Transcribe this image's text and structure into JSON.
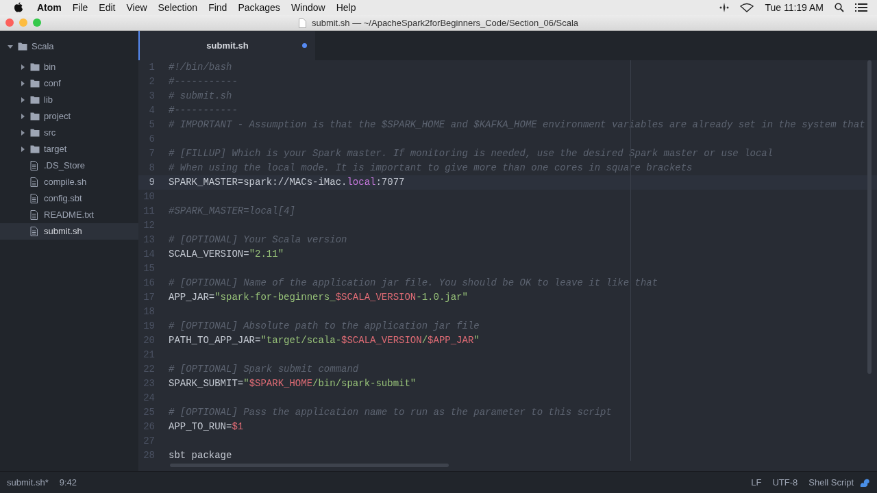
{
  "menu_bar": {
    "items": [
      {
        "label": "Atom",
        "kind": "app"
      },
      {
        "label": "File",
        "kind": "menu"
      },
      {
        "label": "Edit",
        "kind": "menu"
      },
      {
        "label": "View",
        "kind": "menu"
      },
      {
        "label": "Selection",
        "kind": "menu"
      },
      {
        "label": "Find",
        "kind": "menu"
      },
      {
        "label": "Packages",
        "kind": "menu"
      },
      {
        "label": "Window",
        "kind": "menu"
      },
      {
        "label": "Help",
        "kind": "menu"
      }
    ],
    "clock": "Tue 11:19 AM"
  },
  "window": {
    "title": "submit.sh — ~/ApacheSpark2forBeginners_Code/Section_06/Scala"
  },
  "tree": [
    {
      "label": "Scala",
      "kind": "folder",
      "expanded": true,
      "selected": false,
      "children": [
        {
          "label": "bin",
          "kind": "folder",
          "expanded": false,
          "selected": false
        },
        {
          "label": "conf",
          "kind": "folder",
          "expanded": false,
          "selected": false
        },
        {
          "label": "lib",
          "kind": "folder",
          "expanded": false,
          "selected": false
        },
        {
          "label": "project",
          "kind": "folder",
          "expanded": false,
          "selected": false
        },
        {
          "label": "src",
          "kind": "folder",
          "expanded": false,
          "selected": false
        },
        {
          "label": "target",
          "kind": "folder",
          "expanded": false,
          "selected": false
        },
        {
          "label": ".DS_Store",
          "kind": "file",
          "selected": false
        },
        {
          "label": "compile.sh",
          "kind": "file",
          "selected": false
        },
        {
          "label": "config.sbt",
          "kind": "file",
          "selected": false
        },
        {
          "label": "README.txt",
          "kind": "file",
          "selected": false
        },
        {
          "label": "submit.sh",
          "kind": "file",
          "selected": true
        }
      ]
    }
  ],
  "tabs": [
    {
      "label": "submit.sh",
      "selected": true,
      "modified": true
    }
  ],
  "editor": {
    "lines": [
      {
        "number": "1",
        "current": false,
        "tokens": [
          {
            "kind": "comment",
            "text": "#!/bin/bash"
          }
        ]
      },
      {
        "number": "2",
        "current": false,
        "tokens": [
          {
            "kind": "comment",
            "text": "#-----------"
          }
        ]
      },
      {
        "number": "3",
        "current": false,
        "tokens": [
          {
            "kind": "comment",
            "text": "# submit.sh"
          }
        ]
      },
      {
        "number": "4",
        "current": false,
        "tokens": [
          {
            "kind": "comment",
            "text": "#-----------"
          }
        ]
      },
      {
        "number": "5",
        "current": false,
        "tokens": [
          {
            "kind": "comment",
            "text": "# IMPORTANT - Assumption is that the $SPARK_HOME and $KAFKA_HOME environment variables are already set in the system that"
          }
        ]
      },
      {
        "number": "6",
        "current": false
      },
      {
        "number": "7",
        "current": false,
        "tokens": [
          {
            "kind": "comment",
            "text": "# [FILLUP] Which is your Spark master. If monitoring is needed, use the desired Spark master or use local"
          }
        ]
      },
      {
        "number": "8",
        "current": false,
        "tokens": [
          {
            "kind": "comment",
            "text": "# When using the local mode. It is important to give more than one cores in square brackets"
          }
        ]
      },
      {
        "number": "9",
        "current": true,
        "tokens": [
          {
            "kind": "text",
            "text": "SPARK_MASTER=spark://MACs-iMac."
          },
          {
            "kind": "keyword",
            "text": "local"
          },
          {
            "kind": "text",
            "text": ":7077"
          }
        ]
      },
      {
        "number": "10",
        "current": false
      },
      {
        "number": "11",
        "current": false,
        "tokens": [
          {
            "kind": "comment",
            "text": "#SPARK_MASTER=local[4]"
          }
        ]
      },
      {
        "number": "12",
        "current": false
      },
      {
        "number": "13",
        "current": false,
        "tokens": [
          {
            "kind": "comment",
            "text": "# [OPTIONAL] Your Scala version"
          }
        ]
      },
      {
        "number": "14",
        "current": false,
        "tokens": [
          {
            "kind": "text",
            "text": "SCALA_VERSION="
          },
          {
            "kind": "string",
            "text": "\"2.11\""
          }
        ]
      },
      {
        "number": "15",
        "current": false
      },
      {
        "number": "16",
        "current": false,
        "tokens": [
          {
            "kind": "comment",
            "text": "# [OPTIONAL] Name of the application jar file. You should be OK to leave it like that"
          }
        ]
      },
      {
        "number": "17",
        "current": false,
        "tokens": [
          {
            "kind": "text",
            "text": "APP_JAR="
          },
          {
            "kind": "string",
            "text": "\"spark-for-beginners_"
          },
          {
            "kind": "variable",
            "text": "$SCALA_VERSION"
          },
          {
            "kind": "string",
            "text": "-1.0.jar\""
          }
        ]
      },
      {
        "number": "18",
        "current": false
      },
      {
        "number": "19",
        "current": false,
        "tokens": [
          {
            "kind": "comment",
            "text": "# [OPTIONAL] Absolute path to the application jar file"
          }
        ]
      },
      {
        "number": "20",
        "current": false,
        "tokens": [
          {
            "kind": "text",
            "text": "PATH_TO_APP_JAR="
          },
          {
            "kind": "string",
            "text": "\"target/scala-"
          },
          {
            "kind": "variable",
            "text": "$SCALA_VERSION"
          },
          {
            "kind": "string",
            "text": "/"
          },
          {
            "kind": "variable",
            "text": "$APP_JAR"
          },
          {
            "kind": "string",
            "text": "\""
          }
        ]
      },
      {
        "number": "21",
        "current": false
      },
      {
        "number": "22",
        "current": false,
        "tokens": [
          {
            "kind": "comment",
            "text": "# [OPTIONAL] Spark submit command"
          }
        ]
      },
      {
        "number": "23",
        "current": false,
        "tokens": [
          {
            "kind": "text",
            "text": "SPARK_SUBMIT="
          },
          {
            "kind": "string",
            "text": "\""
          },
          {
            "kind": "variable",
            "text": "$SPARK_HOME"
          },
          {
            "kind": "string",
            "text": "/bin/spark-submit\""
          }
        ]
      },
      {
        "number": "24",
        "current": false
      },
      {
        "number": "25",
        "current": false,
        "tokens": [
          {
            "kind": "comment",
            "text": "# [OPTIONAL] Pass the application name to run as the parameter to this script"
          }
        ]
      },
      {
        "number": "26",
        "current": false,
        "tokens": [
          {
            "kind": "text",
            "text": "APP_TO_RUN="
          },
          {
            "kind": "variable",
            "text": "$1"
          }
        ]
      },
      {
        "number": "27",
        "current": false
      },
      {
        "number": "28",
        "current": false,
        "tokens": [
          {
            "kind": "text",
            "text": "sbt package"
          }
        ]
      }
    ]
  },
  "status_bar": {
    "file": "submit.sh*",
    "cursor": "9:42",
    "line_ending": "LF",
    "encoding": "UTF-8",
    "grammar": "Shell Script"
  }
}
